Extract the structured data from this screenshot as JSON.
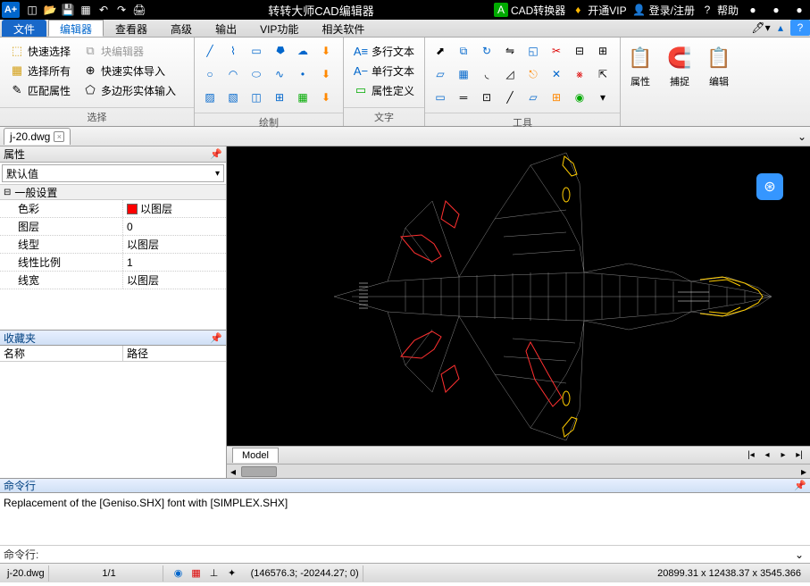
{
  "titlebar": {
    "title": "转转大师CAD编辑器",
    "converter": "CAD转换器",
    "vip": "开通VIP",
    "login": "登录/注册",
    "help": "帮助"
  },
  "menu": {
    "file": "文件",
    "editor": "编辑器",
    "viewer": "查看器",
    "advanced": "高级",
    "output": "输出",
    "vip": "VIP功能",
    "related": "相关软件"
  },
  "ribbon": {
    "select": {
      "label": "选择",
      "quick": "快速选择",
      "block": "块编辑器",
      "all": "选择所有",
      "entity": "快速实体导入",
      "match": "匹配属性",
      "poly": "多边形实体输入"
    },
    "draw": {
      "label": "绘制"
    },
    "text": {
      "label": "文字",
      "multi": "多行文本",
      "single": "单行文本",
      "attr": "属性定义"
    },
    "tools": {
      "label": "工具"
    },
    "props": {
      "attr": "属性",
      "snap": "捕捉",
      "edit": "编辑"
    }
  },
  "doc": {
    "name": "j-20.dwg"
  },
  "props": {
    "title": "属性",
    "default": "默认值",
    "general": "一般设置",
    "rows": [
      {
        "n": "色彩",
        "v": "以图层",
        "swatch": true
      },
      {
        "n": "图层",
        "v": "0"
      },
      {
        "n": "线型",
        "v": "以图层"
      },
      {
        "n": "线性比例",
        "v": "1"
      },
      {
        "n": "线宽",
        "v": "以图层"
      }
    ],
    "favorites": "收藏夹",
    "name": "名称",
    "path": "路径"
  },
  "model": {
    "tab": "Model"
  },
  "cmd": {
    "title": "命令行",
    "log": "Replacement of the [Geniso.SHX] font with [SIMPLEX.SHX]",
    "prompt": "命令行:"
  },
  "status": {
    "file": "j-20.dwg",
    "page": "1/1",
    "cursor": "(146576.3; -20244.27; 0)",
    "bounds": "20899.31 x 12438.37 x 3545.366"
  }
}
